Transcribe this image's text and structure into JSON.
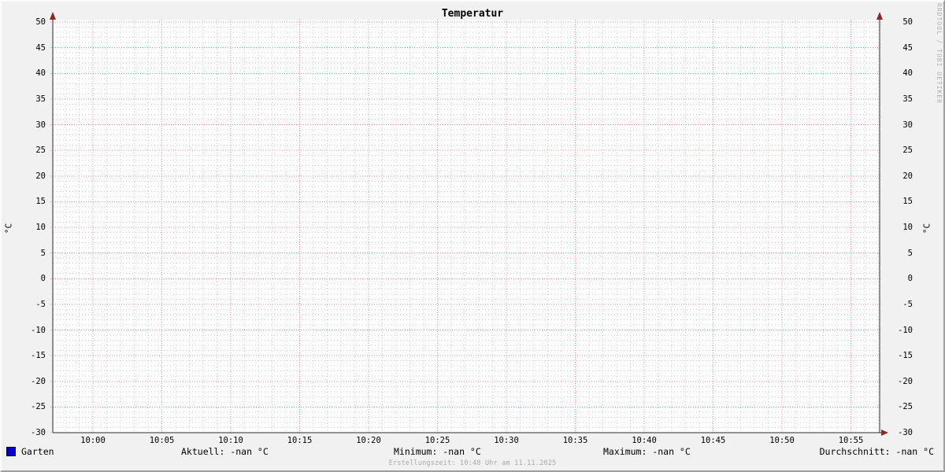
{
  "title": "Temperatur",
  "watermark": "RRDTOOL / TOBI OETIKER",
  "footer": "Erstellungszeit: 10:48 Uhr am 11.11.2025",
  "y_axis_label_left": "°C",
  "y_axis_label_right": "°C",
  "legend": {
    "series_label": "Garten",
    "series_color": "#0000c8",
    "stats": {
      "aktuell": "Aktuell: -nan °C",
      "minimum": "Minimum: -nan °C",
      "maximum": "Maximum: -nan °C",
      "durchschnitt": "Durchschnitt: -nan °C"
    }
  },
  "chart_data": {
    "type": "line",
    "title": "Temperatur",
    "ylabel": "°C",
    "ylim": [
      -30,
      50
    ],
    "y_tick_step": 5,
    "y_ticks": [
      50,
      45,
      40,
      35,
      30,
      25,
      20,
      15,
      10,
      5,
      0,
      -5,
      -10,
      -15,
      -20,
      -25,
      -30
    ],
    "x_ticks": [
      "10:00",
      "10:05",
      "10:10",
      "10:15",
      "10:20",
      "10:25",
      "10:30",
      "10:35",
      "10:40",
      "10:45",
      "10:50",
      "10:55"
    ],
    "x_minor_per_major": 5,
    "grid": {
      "on": true,
      "major_color": "#f08f8f",
      "minor_color": "#b9b9b9",
      "canvas_color": "#ffffff",
      "axis_color": "#2a2a2a",
      "arrow_color": "#8b2a24"
    },
    "legend_position": "bottom",
    "series": [
      {
        "name": "Garten",
        "color": "#0000c8",
        "values": []
      }
    ],
    "note_values": "no data in window; Aktuell/Minimum/Maximum/Durchschnitt all -nan"
  }
}
